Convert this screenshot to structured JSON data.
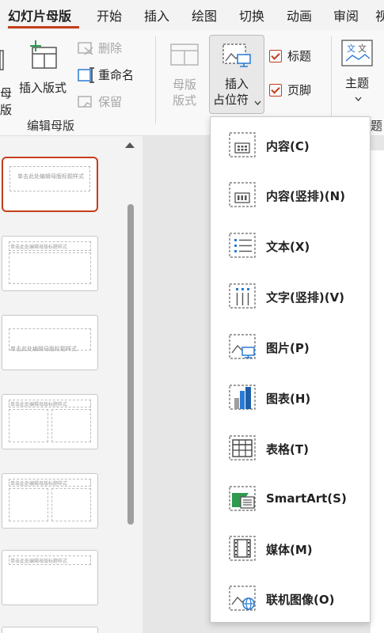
{
  "tabs": [
    {
      "label": "幻灯片母版"
    },
    {
      "label": "开始"
    },
    {
      "label": "插入"
    },
    {
      "label": "绘图"
    },
    {
      "label": "切换"
    },
    {
      "label": "动画"
    },
    {
      "label": "审阅"
    },
    {
      "label": "视"
    }
  ],
  "ribbon": {
    "left_cut_line1": "母",
    "left_cut_line2": "版",
    "insert_layout": "插入版式",
    "delete": "删除",
    "rename": "重命名",
    "preserve": "保留",
    "group_edit_master": "编辑母版",
    "master_layout_line1": "母版",
    "master_layout_line2": "版式",
    "insert_placeholder_line1": "插入",
    "insert_placeholder_line2": "占位符",
    "title_checkbox": "标题",
    "footer_checkbox": "页脚",
    "theme": "主题",
    "group_cut": "题"
  },
  "thumbnails": [
    {
      "title": "单击此处编辑母版标题样式"
    },
    {
      "title": "单击此处编辑母版标题样式"
    },
    {
      "title": "单击此处编辑母版标题样式"
    },
    {
      "title": "单击此处编辑母版标题样式"
    },
    {
      "title": "单击此处编辑母版标题样式"
    },
    {
      "title": "单击此处编辑母版标题样式"
    }
  ],
  "placeholder_menu": [
    {
      "label": "内容(C)",
      "icon": "content-icon"
    },
    {
      "label": "内容(竖排)(N)",
      "icon": "content-vertical-icon"
    },
    {
      "label": "文本(X)",
      "icon": "text-icon"
    },
    {
      "label": "文字(竖排)(V)",
      "icon": "text-vertical-icon"
    },
    {
      "label": "图片(P)",
      "icon": "picture-icon"
    },
    {
      "label": "图表(H)",
      "icon": "chart-icon"
    },
    {
      "label": "表格(T)",
      "icon": "table-icon"
    },
    {
      "label": "SmartArt(S)",
      "icon": "smartart-icon"
    },
    {
      "label": "媒体(M)",
      "icon": "media-icon"
    },
    {
      "label": "联机图像(O)",
      "icon": "online-image-icon"
    }
  ],
  "colors": {
    "accent": "#c43e1c",
    "icon_blue": "#2b7bd4",
    "icon_gray": "#666666"
  }
}
